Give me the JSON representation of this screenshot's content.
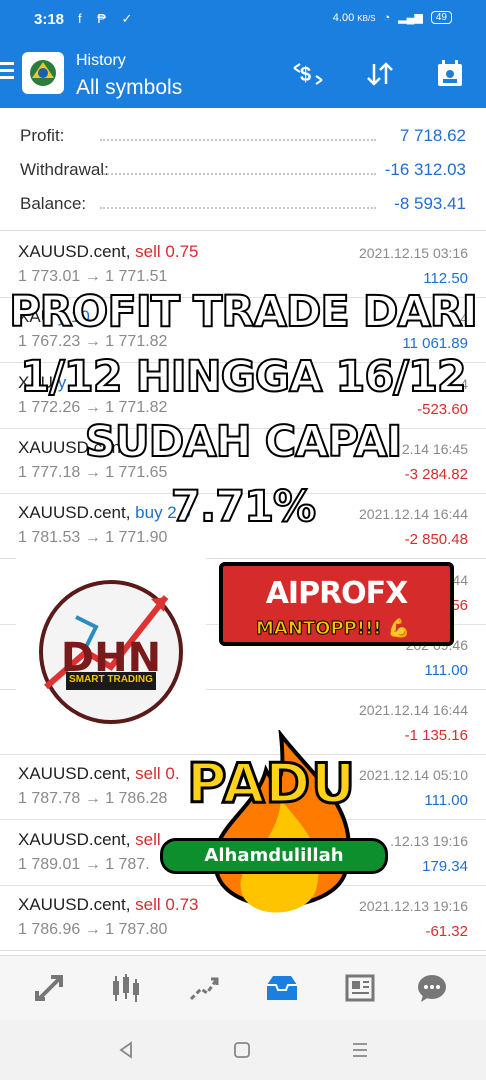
{
  "status_bar": {
    "time": "3:18",
    "network_speed": "4.00",
    "network_speed_unit": "KB/S",
    "battery": "49"
  },
  "app_bar": {
    "subtitle": "History",
    "title": "All symbols"
  },
  "summary": [
    {
      "label": "Profit:",
      "value": "7 718.62"
    },
    {
      "label": "Withdrawal:",
      "value": "-16 312.03"
    },
    {
      "label": "Balance:",
      "value": "-8 593.41"
    }
  ],
  "trades": [
    {
      "symbol": "XAUUSD.cent,",
      "side": "sell 0.75",
      "side_type": "sell",
      "date": "2021.12.15 03:16",
      "prices": "1 773.01 → 1 771.51",
      "pl": "112.50",
      "pl_type": "pos"
    },
    {
      "symbol": "XAU",
      "side": "y 10",
      "side_type": "buy",
      "date": "4",
      "prices": "1 767.23 → 1 771.82",
      "pl": "11 061.89",
      "pl_type": "pos"
    },
    {
      "symbol": "XAU",
      "side": "y",
      "side_type": "buy",
      "date": "4",
      "prices": "1 772.26 → 1 771.82",
      "pl": "-523.60",
      "pl_type": "neg"
    },
    {
      "symbol": "XAUUSD.cen",
      "side": "",
      "side_type": "buy",
      "date": "2.14 16:45",
      "prices": "1 777.18 → 1 771.65",
      "pl": "-3 284.82",
      "pl_type": "neg"
    },
    {
      "symbol": "XAUUSD.cent,",
      "side": "buy 2.9",
      "side_type": "buy",
      "date": "2021.12.14 16:44",
      "prices": "1 781.53 → 1 771.90",
      "pl": "-2 850.48",
      "pl_type": "neg"
    },
    {
      "symbol": "",
      "side": "3",
      "side_type": "buy",
      "date": "44",
      "prices": "",
      "pl": "56",
      "pl_type": "neg"
    },
    {
      "symbol": "",
      "side": "4",
      "side_type": "buy",
      "date": "202 09:46",
      "prices": "",
      "pl": "111.00",
      "pl_type": "pos"
    },
    {
      "symbol": "",
      "side": "4",
      "side_type": "buy",
      "date": "2021.12.14 16:44",
      "prices": "",
      "pl": "-1 135.16",
      "pl_type": "neg"
    },
    {
      "symbol": "XAUUSD.cent,",
      "side": "sell 0.",
      "side_type": "sell",
      "date": "2021.12.14 05:10",
      "prices": "1 787.78 → 1 786.28",
      "pl": "111.00",
      "pl_type": "pos"
    },
    {
      "symbol": "XAUUSD.cent,",
      "side": "sell",
      "side_type": "sell",
      "date": ".12.13 19:16",
      "prices": "1 789.01 → 1 787.",
      "pl": "179.34",
      "pl_type": "pos"
    },
    {
      "symbol": "XAUUSD.cent,",
      "side": "sell 0.73",
      "side_type": "sell",
      "date": "2021.12.13 19:16",
      "prices": "1 786.96 → 1 787.80",
      "pl": "-61.32",
      "pl_type": "neg"
    }
  ],
  "overlay": {
    "line1": "PROFIT TRADE DARI",
    "line2": "1/12 HINGGA 16/12",
    "line3": "SUDAH CAPAI",
    "line4": "7.71%"
  },
  "stickers": {
    "dhn_logo": "DHN",
    "dhn_tagline": "SMART TRADING",
    "broker": "AIPROFX",
    "mantop": "MANTOPP!!!",
    "padu": "PADU",
    "alhamdulillah": "Alhamdulillah"
  },
  "icons": {
    "menu": "menu-icon",
    "currency_swap": "currency-swap-icon",
    "sort": "sort-icon",
    "calendar": "calendar-icon"
  }
}
